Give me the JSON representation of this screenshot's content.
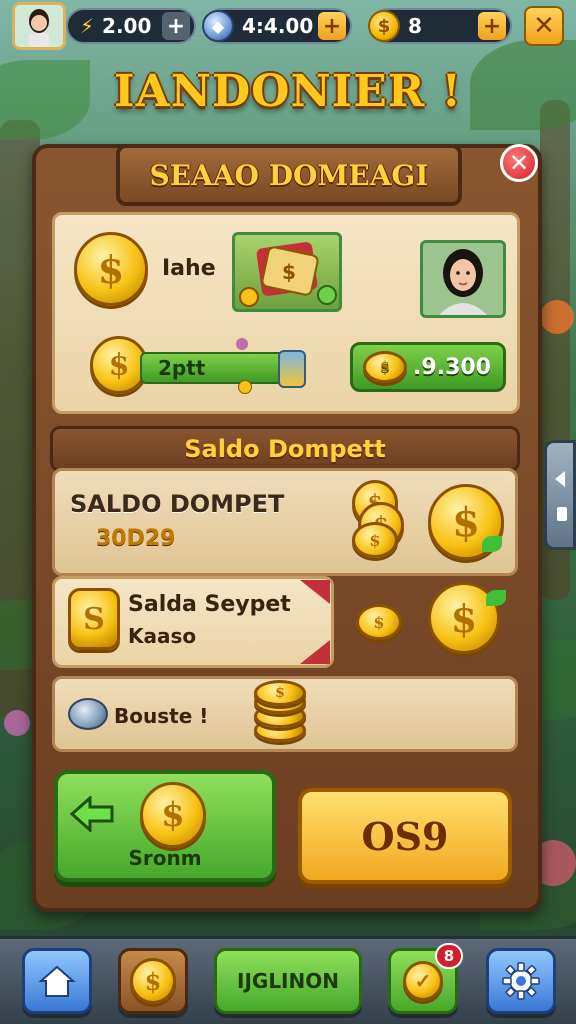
{
  "top_bar": {
    "resource_1": "2.00",
    "resource_2": "4:4.00",
    "resource_3": "8",
    "plus_symbol": "+"
  },
  "game_title": "IANDONIER !",
  "panel": {
    "banner_title": "SEAAO DOMEAGI",
    "card_top": {
      "label": "Iahe",
      "bar_label": "2ptt",
      "balance_value": ".9.300"
    },
    "section_title": "Saldo Dompett",
    "wallet_row": {
      "title": "SALDO DOMPET",
      "value": "30D29"
    },
    "transfer_row": {
      "title": "Salda Seypet",
      "subtitle": "Kaaso"
    },
    "bonus_row": {
      "label": "Bouste !"
    },
    "green_button_label": "Sronm",
    "yellow_button_label": "OS9"
  },
  "bottom_nav": {
    "center_label": "IJGLINON",
    "notification_badge": "8"
  },
  "colors": {
    "gold": "#ffc81e",
    "panel_wood": "#7a4a24",
    "accent_green": "#46a82a",
    "accent_red": "#d1202a"
  }
}
